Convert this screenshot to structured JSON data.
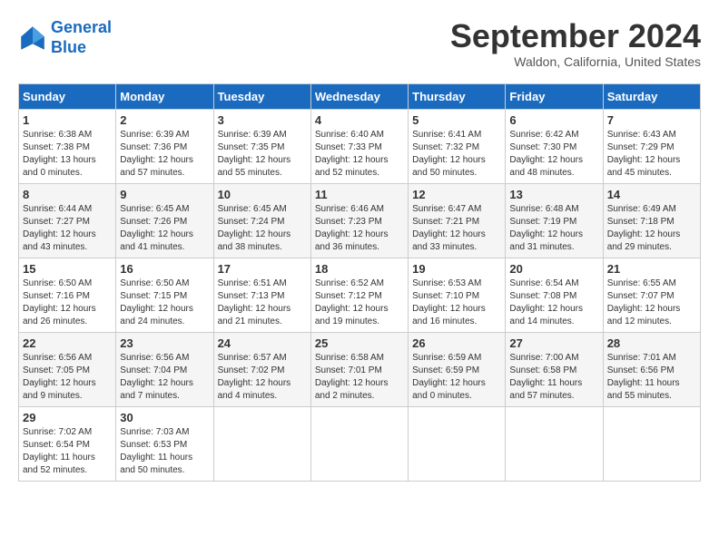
{
  "logo": {
    "line1": "General",
    "line2": "Blue"
  },
  "title": "September 2024",
  "location": "Waldon, California, United States",
  "days_of_week": [
    "Sunday",
    "Monday",
    "Tuesday",
    "Wednesday",
    "Thursday",
    "Friday",
    "Saturday"
  ],
  "weeks": [
    [
      {
        "day": "1",
        "sunrise": "Sunrise: 6:38 AM",
        "sunset": "Sunset: 7:38 PM",
        "daylight": "Daylight: 13 hours and 0 minutes."
      },
      {
        "day": "2",
        "sunrise": "Sunrise: 6:39 AM",
        "sunset": "Sunset: 7:36 PM",
        "daylight": "Daylight: 12 hours and 57 minutes."
      },
      {
        "day": "3",
        "sunrise": "Sunrise: 6:39 AM",
        "sunset": "Sunset: 7:35 PM",
        "daylight": "Daylight: 12 hours and 55 minutes."
      },
      {
        "day": "4",
        "sunrise": "Sunrise: 6:40 AM",
        "sunset": "Sunset: 7:33 PM",
        "daylight": "Daylight: 12 hours and 52 minutes."
      },
      {
        "day": "5",
        "sunrise": "Sunrise: 6:41 AM",
        "sunset": "Sunset: 7:32 PM",
        "daylight": "Daylight: 12 hours and 50 minutes."
      },
      {
        "day": "6",
        "sunrise": "Sunrise: 6:42 AM",
        "sunset": "Sunset: 7:30 PM",
        "daylight": "Daylight: 12 hours and 48 minutes."
      },
      {
        "day": "7",
        "sunrise": "Sunrise: 6:43 AM",
        "sunset": "Sunset: 7:29 PM",
        "daylight": "Daylight: 12 hours and 45 minutes."
      }
    ],
    [
      {
        "day": "8",
        "sunrise": "Sunrise: 6:44 AM",
        "sunset": "Sunset: 7:27 PM",
        "daylight": "Daylight: 12 hours and 43 minutes."
      },
      {
        "day": "9",
        "sunrise": "Sunrise: 6:45 AM",
        "sunset": "Sunset: 7:26 PM",
        "daylight": "Daylight: 12 hours and 41 minutes."
      },
      {
        "day": "10",
        "sunrise": "Sunrise: 6:45 AM",
        "sunset": "Sunset: 7:24 PM",
        "daylight": "Daylight: 12 hours and 38 minutes."
      },
      {
        "day": "11",
        "sunrise": "Sunrise: 6:46 AM",
        "sunset": "Sunset: 7:23 PM",
        "daylight": "Daylight: 12 hours and 36 minutes."
      },
      {
        "day": "12",
        "sunrise": "Sunrise: 6:47 AM",
        "sunset": "Sunset: 7:21 PM",
        "daylight": "Daylight: 12 hours and 33 minutes."
      },
      {
        "day": "13",
        "sunrise": "Sunrise: 6:48 AM",
        "sunset": "Sunset: 7:19 PM",
        "daylight": "Daylight: 12 hours and 31 minutes."
      },
      {
        "day": "14",
        "sunrise": "Sunrise: 6:49 AM",
        "sunset": "Sunset: 7:18 PM",
        "daylight": "Daylight: 12 hours and 29 minutes."
      }
    ],
    [
      {
        "day": "15",
        "sunrise": "Sunrise: 6:50 AM",
        "sunset": "Sunset: 7:16 PM",
        "daylight": "Daylight: 12 hours and 26 minutes."
      },
      {
        "day": "16",
        "sunrise": "Sunrise: 6:50 AM",
        "sunset": "Sunset: 7:15 PM",
        "daylight": "Daylight: 12 hours and 24 minutes."
      },
      {
        "day": "17",
        "sunrise": "Sunrise: 6:51 AM",
        "sunset": "Sunset: 7:13 PM",
        "daylight": "Daylight: 12 hours and 21 minutes."
      },
      {
        "day": "18",
        "sunrise": "Sunrise: 6:52 AM",
        "sunset": "Sunset: 7:12 PM",
        "daylight": "Daylight: 12 hours and 19 minutes."
      },
      {
        "day": "19",
        "sunrise": "Sunrise: 6:53 AM",
        "sunset": "Sunset: 7:10 PM",
        "daylight": "Daylight: 12 hours and 16 minutes."
      },
      {
        "day": "20",
        "sunrise": "Sunrise: 6:54 AM",
        "sunset": "Sunset: 7:08 PM",
        "daylight": "Daylight: 12 hours and 14 minutes."
      },
      {
        "day": "21",
        "sunrise": "Sunrise: 6:55 AM",
        "sunset": "Sunset: 7:07 PM",
        "daylight": "Daylight: 12 hours and 12 minutes."
      }
    ],
    [
      {
        "day": "22",
        "sunrise": "Sunrise: 6:56 AM",
        "sunset": "Sunset: 7:05 PM",
        "daylight": "Daylight: 12 hours and 9 minutes."
      },
      {
        "day": "23",
        "sunrise": "Sunrise: 6:56 AM",
        "sunset": "Sunset: 7:04 PM",
        "daylight": "Daylight: 12 hours and 7 minutes."
      },
      {
        "day": "24",
        "sunrise": "Sunrise: 6:57 AM",
        "sunset": "Sunset: 7:02 PM",
        "daylight": "Daylight: 12 hours and 4 minutes."
      },
      {
        "day": "25",
        "sunrise": "Sunrise: 6:58 AM",
        "sunset": "Sunset: 7:01 PM",
        "daylight": "Daylight: 12 hours and 2 minutes."
      },
      {
        "day": "26",
        "sunrise": "Sunrise: 6:59 AM",
        "sunset": "Sunset: 6:59 PM",
        "daylight": "Daylight: 12 hours and 0 minutes."
      },
      {
        "day": "27",
        "sunrise": "Sunrise: 7:00 AM",
        "sunset": "Sunset: 6:58 PM",
        "daylight": "Daylight: 11 hours and 57 minutes."
      },
      {
        "day": "28",
        "sunrise": "Sunrise: 7:01 AM",
        "sunset": "Sunset: 6:56 PM",
        "daylight": "Daylight: 11 hours and 55 minutes."
      }
    ],
    [
      {
        "day": "29",
        "sunrise": "Sunrise: 7:02 AM",
        "sunset": "Sunset: 6:54 PM",
        "daylight": "Daylight: 11 hours and 52 minutes."
      },
      {
        "day": "30",
        "sunrise": "Sunrise: 7:03 AM",
        "sunset": "Sunset: 6:53 PM",
        "daylight": "Daylight: 11 hours and 50 minutes."
      },
      null,
      null,
      null,
      null,
      null
    ]
  ]
}
